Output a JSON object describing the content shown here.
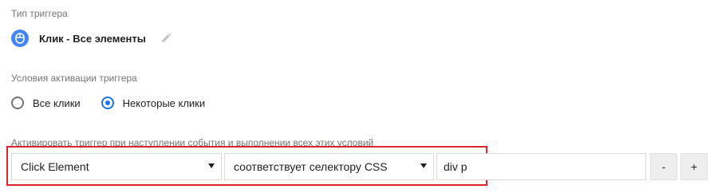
{
  "trigger_type": {
    "label": "Тип триггера",
    "name": "Клик - Все элементы",
    "icon": "mouse-icon",
    "accent": "#4285f4"
  },
  "activation": {
    "label": "Условия активации триггера",
    "options": [
      {
        "label": "Все клики",
        "checked": false
      },
      {
        "label": "Некоторые клики",
        "checked": true
      }
    ]
  },
  "conditions": {
    "label": "Активировать триггер при наступлении события и выполнении всех этих условий",
    "variable": "Click Element",
    "operator": "соответствует селектору CSS",
    "value": "div p",
    "remove_label": "-",
    "add_label": "+",
    "highlight_color": "#d7262c"
  }
}
